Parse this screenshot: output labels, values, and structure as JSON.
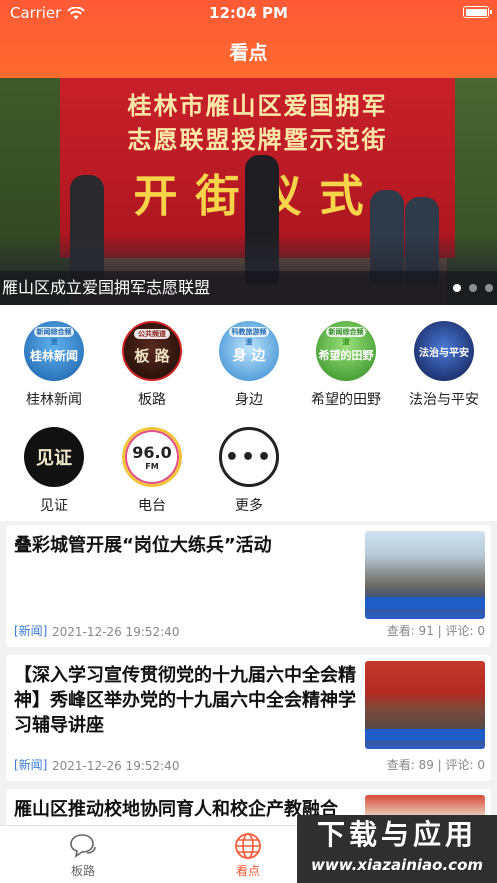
{
  "status_bar": {
    "carrier": "Carrier",
    "time": "12:04 PM"
  },
  "nav": {
    "title": "看点"
  },
  "banner": {
    "backdrop_line1": "桂林市雁山区爱国拥军",
    "backdrop_line2": "志愿联盟授牌暨示范街",
    "backdrop_big": "开街仪式",
    "caption": "雁山区成立爱国拥军志愿联盟",
    "page_count": 3,
    "active_page": 1
  },
  "channels": [
    {
      "label": "桂林新闻",
      "icon_text": "桂林新闻",
      "badge": "新闻综合频道",
      "color": "#2a7cc0",
      "icon": "guilin-news-icon"
    },
    {
      "label": "板路",
      "icon_text": "板 路",
      "badge": "公共频道",
      "color": "#3a1a14",
      "icon": "banlu-icon"
    },
    {
      "label": "身边",
      "icon_text": "身 边",
      "badge": "科教旅游频道",
      "color": "#6fb6e8",
      "icon": "shenbian-icon"
    },
    {
      "label": "希望的田野",
      "icon_text": "希望的田野",
      "badge": "新闻综合频道",
      "color": "#4caf3a",
      "icon": "hope-field-icon"
    },
    {
      "label": "法治与平安",
      "icon_text": "法治与平安",
      "badge": "",
      "color": "#1a2c6a",
      "icon": "law-safety-icon"
    },
    {
      "label": "见证",
      "icon_text": "见证",
      "badge": "",
      "color": "#1a1a1a",
      "icon": "witness-icon"
    },
    {
      "label": "电台",
      "icon_text": "96.0",
      "badge": "FM",
      "color": "#ffffff",
      "icon": "radio-icon"
    },
    {
      "label": "更多",
      "icon_text": "•••",
      "badge": "",
      "color": "#ffffff",
      "icon": "more-icon"
    }
  ],
  "articles": [
    {
      "title": "叠彩城管开展“岗位大练兵”活动",
      "tag": "[新闻]",
      "time": "2021-12-26 19:52:40",
      "stats": "查看: 91 | 评论: 0"
    },
    {
      "title": "【深入学习宣传贯彻党的十九届六中全会精神】秀峰区举办党的十九届六中全会精神学习辅导讲座",
      "tag": "[新闻]",
      "time": "2021-12-26 19:52:40",
      "stats": "查看: 89 | 评论: 0"
    },
    {
      "title": "雁山区推动校地协同育人和校企产教融合",
      "tag": "",
      "time": "",
      "stats": ""
    }
  ],
  "tabbar": {
    "tabs": [
      {
        "label": "板路",
        "icon": "chat-bubbles-icon",
        "active": false
      },
      {
        "label": "看点",
        "icon": "globe-icon",
        "active": true
      }
    ]
  },
  "watermark": {
    "line1": "下载与应用",
    "line2": "www.xiazainiao.com"
  },
  "colors": {
    "accent": "#ff5a36",
    "link": "#3a7bd5"
  }
}
